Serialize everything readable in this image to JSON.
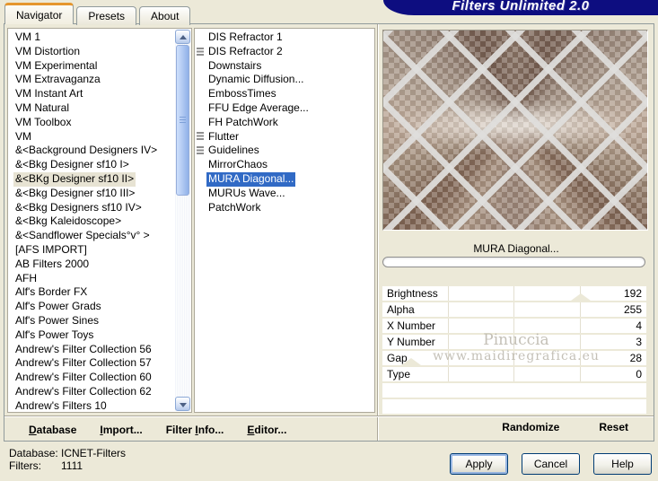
{
  "window": {
    "title": "Filters Unlimited 2.0"
  },
  "tabs": [
    {
      "label": "Navigator",
      "active": true
    },
    {
      "label": "Presets",
      "active": false
    },
    {
      "label": "About",
      "active": false
    }
  ],
  "left_list": {
    "items": [
      {
        "label": "VM 1"
      },
      {
        "label": "VM Distortion"
      },
      {
        "label": "VM Experimental"
      },
      {
        "label": "VM Extravaganza"
      },
      {
        "label": "VM Instant Art"
      },
      {
        "label": "VM Natural"
      },
      {
        "label": "VM Toolbox"
      },
      {
        "label": "VM"
      },
      {
        "label": "&<Background Designers IV>"
      },
      {
        "label": "&<Bkg Designer sf10 I>"
      },
      {
        "label": "&<BKg Designer sf10 II>",
        "selected": true
      },
      {
        "label": "&<Bkg Designer sf10 III>"
      },
      {
        "label": "&<Bkg Designers sf10 IV>"
      },
      {
        "label": "&<Bkg Kaleidoscope>"
      },
      {
        "label": "&<Sandflower Specials°v° >"
      },
      {
        "label": "[AFS IMPORT]"
      },
      {
        "label": "AB Filters 2000"
      },
      {
        "label": "AFH"
      },
      {
        "label": "Alf's Border FX"
      },
      {
        "label": "Alf's Power Grads"
      },
      {
        "label": "Alf's Power Sines"
      },
      {
        "label": "Alf's Power Toys"
      },
      {
        "label": "Andrew's Filter Collection 56"
      },
      {
        "label": "Andrew's Filter Collection 57"
      },
      {
        "label": "Andrew's Filter Collection 60"
      },
      {
        "label": "Andrew's Filter Collection 62"
      },
      {
        "label": "Andrew's Filters 10"
      }
    ]
  },
  "middle_list": {
    "items": [
      {
        "label": "DIS Refractor 1",
        "icon": false
      },
      {
        "label": "DIS Refractor 2",
        "icon": true
      },
      {
        "label": "Downstairs",
        "icon": false
      },
      {
        "label": "Dynamic Diffusion...",
        "icon": false
      },
      {
        "label": "EmbossTimes",
        "icon": false
      },
      {
        "label": "FFU Edge Average...",
        "icon": false
      },
      {
        "label": "FH PatchWork",
        "icon": false
      },
      {
        "label": "Flutter",
        "icon": true
      },
      {
        "label": "Guidelines",
        "icon": true
      },
      {
        "label": "MirrorChaos",
        "icon": false
      },
      {
        "label": "MURA Diagonal...",
        "icon": false,
        "selected": true
      },
      {
        "label": "MURUs Wave...",
        "icon": false
      },
      {
        "label": "PatchWork",
        "icon": false
      }
    ]
  },
  "preview": {
    "filter_name": "MURA Diagonal...",
    "progress_pct": 0
  },
  "params": {
    "rows": [
      {
        "label": "Brightness",
        "value": "192",
        "thumb_pct": 75
      },
      {
        "label": "Alpha",
        "value": "255",
        "thumb_pct": null
      },
      {
        "label": "X Number",
        "value": "4",
        "thumb_pct": null
      },
      {
        "label": "Y Number",
        "value": "3",
        "thumb_pct": null
      },
      {
        "label": "Gap",
        "value": "28",
        "thumb_pct": 11
      },
      {
        "label": "Type",
        "value": "0",
        "thumb_pct": null
      }
    ]
  },
  "watermark": {
    "line1": "Pinuccia",
    "line2": "www.maidiregrafica.eu"
  },
  "toolbar": {
    "items": [
      {
        "pre": "",
        "mn": "D",
        "post": "atabase"
      },
      {
        "pre": "",
        "mn": "I",
        "post": "mport..."
      },
      {
        "pre": "Filter ",
        "mn": "I",
        "post": "nfo..."
      },
      {
        "pre": "",
        "mn": "E",
        "post": "ditor..."
      }
    ]
  },
  "panel_actions": {
    "randomize": "Randomize",
    "reset": "Reset"
  },
  "status": {
    "rows": [
      {
        "label": "Database:",
        "value": "ICNET-Filters"
      },
      {
        "label": "Filters:",
        "value": "1111"
      }
    ]
  },
  "buttons": {
    "apply": "Apply",
    "cancel": "Cancel",
    "help": "Help"
  },
  "colors": {
    "bg": "#ece9d8",
    "banner": "#0d0d80",
    "selection": "#316ac5",
    "tab_accent": "#e5962d"
  }
}
